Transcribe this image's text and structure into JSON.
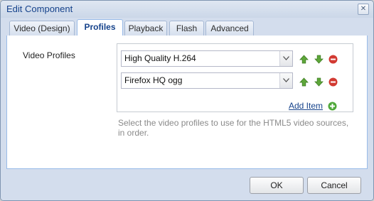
{
  "dialog": {
    "title": "Edit Component",
    "close_icon_name": "close-icon",
    "close_glyph": "✕"
  },
  "tabs": [
    {
      "label": "Video (Design)",
      "active": false
    },
    {
      "label": "Profiles",
      "active": true
    },
    {
      "label": "Playback",
      "active": false
    },
    {
      "label": "Flash",
      "active": false
    },
    {
      "label": "Advanced",
      "active": false
    }
  ],
  "profiles": {
    "label": "Video Profiles",
    "items": [
      {
        "value": "High Quality H.264"
      },
      {
        "value": "Firefox HQ ogg"
      }
    ],
    "add_label": "Add Item",
    "help_text": "Select the video profiles to use for the HTML5 video sources, in order.",
    "icons": {
      "move_up": "arrow-up-icon",
      "move_down": "arrow-down-icon",
      "remove": "remove-icon",
      "add": "add-icon",
      "dropdown": "chevron-down-icon"
    }
  },
  "footer": {
    "ok_label": "OK",
    "cancel_label": "Cancel"
  },
  "colors": {
    "header_bg": "#d3dded",
    "title_text": "#15428b",
    "link": "#15428b",
    "arrow_green": "#5ea73a",
    "remove_red": "#d23a32",
    "add_green": "#4fa83a"
  }
}
